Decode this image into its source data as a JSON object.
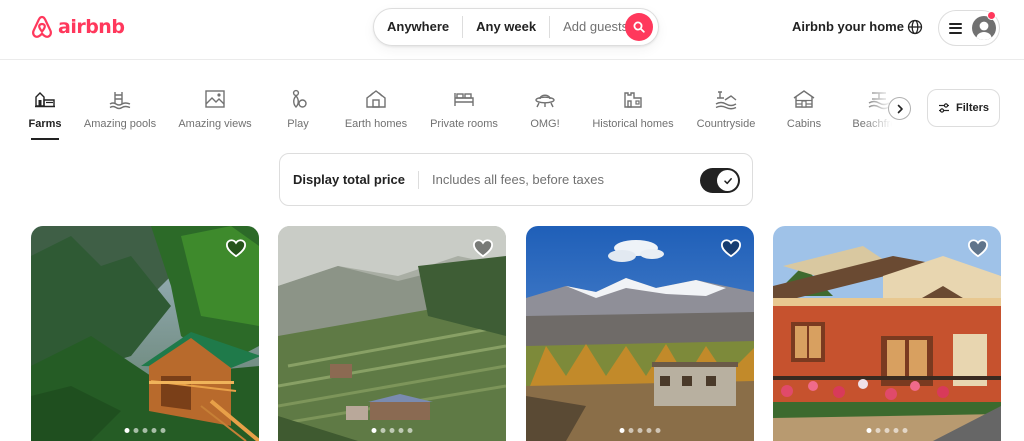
{
  "header": {
    "brand": "airbnb",
    "search": {
      "location": "Anywhere",
      "dates": "Any week",
      "guests_placeholder": "Add guests"
    },
    "host_link": "Airbnb your home"
  },
  "categories": [
    {
      "label": "Farms",
      "icon": "farm-icon",
      "active": true
    },
    {
      "label": "Amazing pools",
      "icon": "pool-icon"
    },
    {
      "label": "Amazing views",
      "icon": "view-icon"
    },
    {
      "label": "Play",
      "icon": "play-icon"
    },
    {
      "label": "Earth homes",
      "icon": "earth-home-icon"
    },
    {
      "label": "Private rooms",
      "icon": "bed-icon"
    },
    {
      "label": "OMG!",
      "icon": "ufo-icon"
    },
    {
      "label": "Historical homes",
      "icon": "castle-icon"
    },
    {
      "label": "Countryside",
      "icon": "countryside-icon"
    },
    {
      "label": "Cabins",
      "icon": "cabin-icon"
    },
    {
      "label": "Beachfront",
      "icon": "beach-icon"
    }
  ],
  "filters_label": "Filters",
  "price_toggle": {
    "title": "Display total price",
    "subtitle": "Includes all fees, before taxes",
    "on": true
  },
  "listings": [
    {
      "photo": "forest-cabin",
      "photo_count": 5,
      "active_photo": 1
    },
    {
      "photo": "terraced-hillside-village",
      "photo_count": 5,
      "active_photo": 1
    },
    {
      "photo": "mountain-valley-house",
      "photo_count": 5,
      "active_photo": 1
    },
    {
      "photo": "red-villa",
      "photo_count": 5,
      "active_photo": 1
    }
  ],
  "colors": {
    "brand": "#ff385c",
    "text": "#222222",
    "muted": "#717171",
    "border": "#dddddd"
  }
}
